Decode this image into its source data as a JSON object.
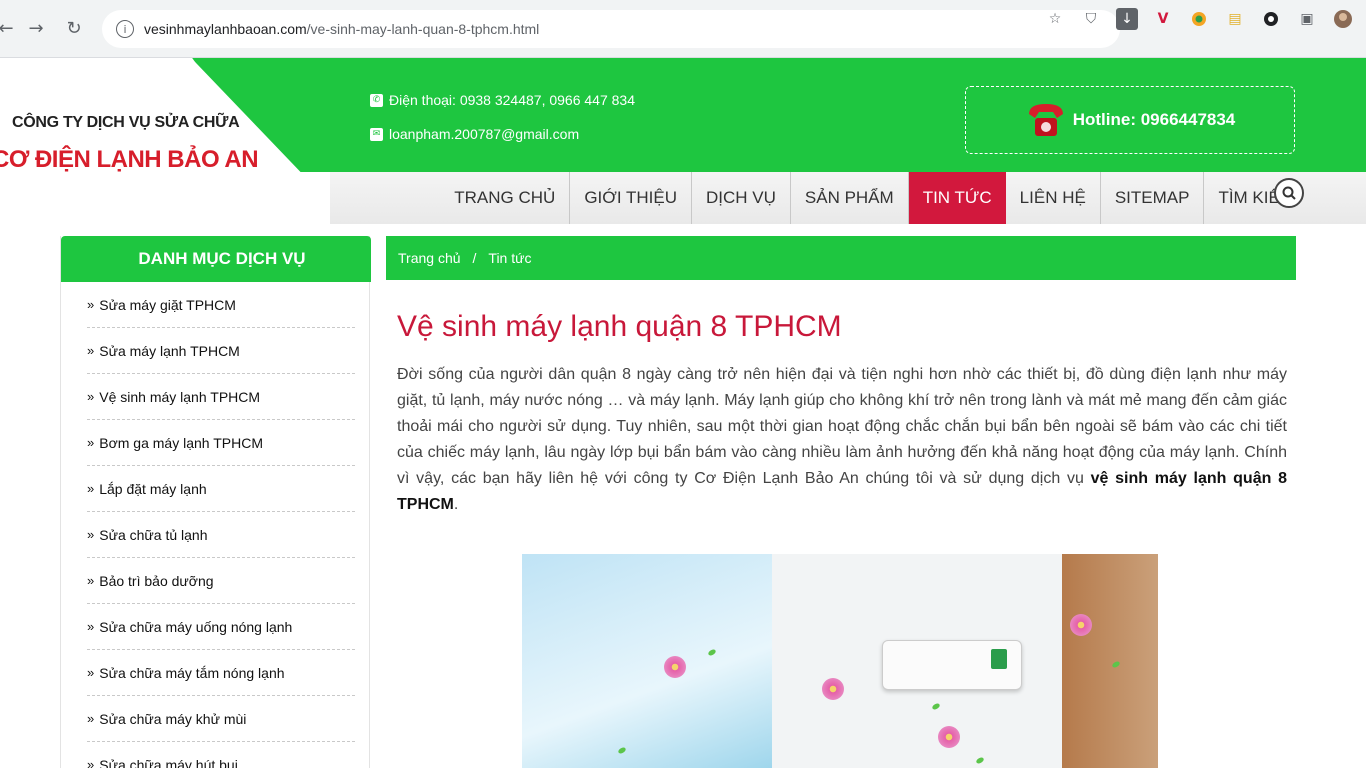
{
  "browser": {
    "back_icon": "arrow-left-icon",
    "forward_icon": "arrow-right-icon",
    "reload_icon": "reload-icon",
    "url_domain": "vesinhmaylanhbaoan.com",
    "url_path": "/ve-sinh-may-lanh-quan-8-tphcm.html",
    "extensions": [
      "star-icon",
      "shield-icon",
      "download-icon",
      "v-icon",
      "chrome-ext-icon",
      "note-icon",
      "circle-icon",
      "puzzle-icon",
      "avatar-icon"
    ]
  },
  "header": {
    "company_small": "CÔNG TY DỊCH VỤ SỬA CHỮA",
    "company_big": "CƠ ĐIỆN LẠNH BẢO AN",
    "phone": "Điện thoại: 0938 324487, 0966 447 834",
    "email": "loanpham.200787@gmail.com",
    "hotline": "Hotline: 0966447834",
    "brand_color": "#1ec640",
    "accent_color": "#d2183d"
  },
  "nav": {
    "items": [
      {
        "label": "TRANG CHỦ"
      },
      {
        "label": "GIỚI THIỆU"
      },
      {
        "label": "DỊCH VỤ"
      },
      {
        "label": "SẢN PHẨM"
      },
      {
        "label": "TIN TỨC"
      },
      {
        "label": "LIÊN HỆ"
      },
      {
        "label": "SITEMAP"
      },
      {
        "label": "TÌM KIẾM"
      }
    ],
    "active": "TIN TỨC"
  },
  "sidebar": {
    "title": "DANH MỤC DỊCH VỤ",
    "items": [
      {
        "label": "Sửa máy giặt TPHCM"
      },
      {
        "label": "Sửa máy lạnh TPHCM"
      },
      {
        "label": "Vệ sinh máy lạnh TPHCM"
      },
      {
        "label": "Bơm ga máy lạnh TPHCM"
      },
      {
        "label": "Lắp đặt máy lạnh"
      },
      {
        "label": "Sửa chữa tủ lạnh"
      },
      {
        "label": "Bảo trì bảo dưỡng"
      },
      {
        "label": "Sửa chữa máy uống nóng lạnh"
      },
      {
        "label": "Sửa chữa máy tắm nóng lạnh"
      },
      {
        "label": "Sửa chữa máy khử mùi"
      },
      {
        "label": "Sửa chữa máy hút bụi"
      }
    ]
  },
  "breadcrumb": {
    "home": "Trang chủ",
    "separator": "/",
    "current": "Tin tức"
  },
  "article": {
    "title": "Vệ sinh máy lạnh quận 8 TPHCM",
    "body": "Đời sống của người dân quận 8 ngày càng trở nên hiện đại và tiện nghi hơn nhờ các thiết bị, đồ dùng điện lạnh như máy giặt, tủ lạnh, máy nước nóng … và máy lạnh. Máy lạnh giúp cho không khí trở nên trong lành và mát mẻ mang đến cảm giác thoải mái cho người sử dụng. Tuy nhiên, sau một thời gian hoạt động chắc chắn bụi bẩn bên ngoài sẽ bám vào các chi tiết của chiếc máy lạnh, lâu ngày lớp bụi bẩn bám vào càng nhiều làm ảnh hưởng đến khả năng hoạt động của máy lạnh. Chính vì vậy, các bạn hãy liên hệ với công ty Cơ Điện Lạnh Bảo An chúng tôi và sử dụng dịch vụ ",
    "body_bold": "vệ sinh máy lạnh quận 8 TPHCM",
    "body_end": "."
  }
}
